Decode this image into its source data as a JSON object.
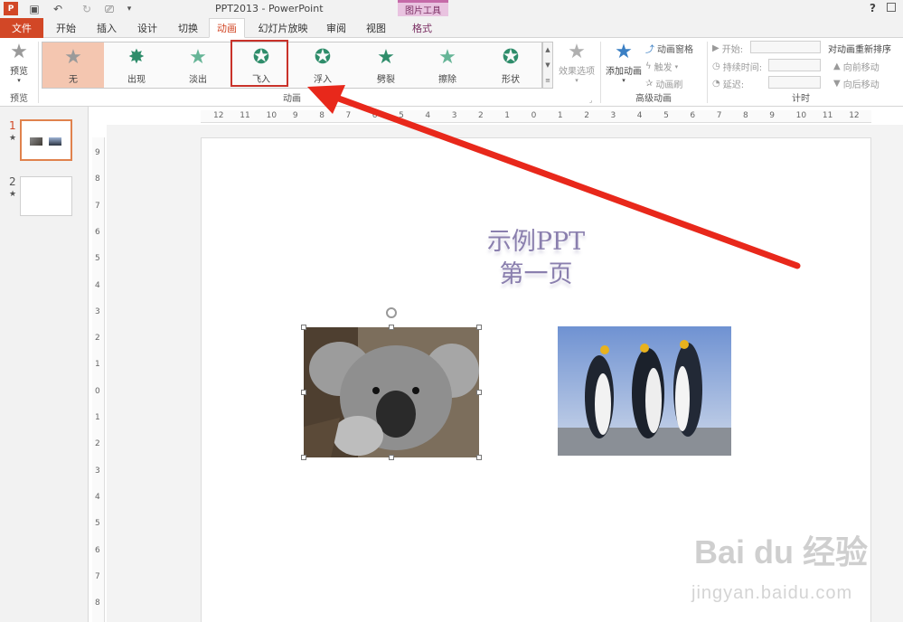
{
  "window": {
    "title": "PPT2013 - PowerPoint",
    "context_group": "图片工具",
    "help": "?"
  },
  "tabs": [
    "文件",
    "开始",
    "插入",
    "设计",
    "切换",
    "动画",
    "幻灯片放映",
    "审阅",
    "视图",
    "格式"
  ],
  "ribbon": {
    "preview": {
      "label": "预览",
      "group": "预览"
    },
    "animations": [
      {
        "label": "无",
        "icon": "star-none-icon"
      },
      {
        "label": "出现",
        "icon": "star-appear-icon"
      },
      {
        "label": "淡出",
        "icon": "star-fade-icon"
      },
      {
        "label": "飞入",
        "icon": "star-fly-in-icon"
      },
      {
        "label": "浮入",
        "icon": "star-float-in-icon"
      },
      {
        "label": "劈裂",
        "icon": "star-split-icon"
      },
      {
        "label": "擦除",
        "icon": "star-wipe-icon"
      },
      {
        "label": "形状",
        "icon": "star-shape-icon"
      }
    ],
    "animation_group": "动画",
    "effect_options": "效果选项",
    "advanced": {
      "add_animation": "添加动画",
      "animation_pane": "动画窗格",
      "trigger": "触发",
      "animation_painter": "动画刷",
      "group": "高级动画"
    },
    "timing": {
      "start": "开始:",
      "duration": "持续时间:",
      "delay": "延迟:",
      "reorder": "对动画重新排序",
      "move_earlier": "向前移动",
      "move_later": "向后移动",
      "group": "计时"
    }
  },
  "slides": [
    {
      "num": "1",
      "star": "★"
    },
    {
      "num": "2",
      "star": "★"
    }
  ],
  "hruler": [
    "12",
    "11",
    "10",
    "9",
    "8",
    "7",
    "6",
    "5",
    "4",
    "3",
    "2",
    "1",
    "0",
    "1",
    "2",
    "3",
    "4",
    "5",
    "6",
    "7",
    "8",
    "9",
    "10",
    "11",
    "12"
  ],
  "vruler": [
    "9",
    "8",
    "7",
    "6",
    "5",
    "4",
    "3",
    "2",
    "1",
    "0",
    "1",
    "2",
    "3",
    "4",
    "5",
    "6",
    "7",
    "8"
  ],
  "slide": {
    "title_line1": "示例PPT",
    "title_line2": "第一页"
  },
  "watermark": {
    "brand": "Bai du 经验",
    "url": "jingyan.baidu.com"
  },
  "colors": {
    "accent": "#d24726",
    "highlight": "#c9322a",
    "arrow": "#e8281b"
  }
}
